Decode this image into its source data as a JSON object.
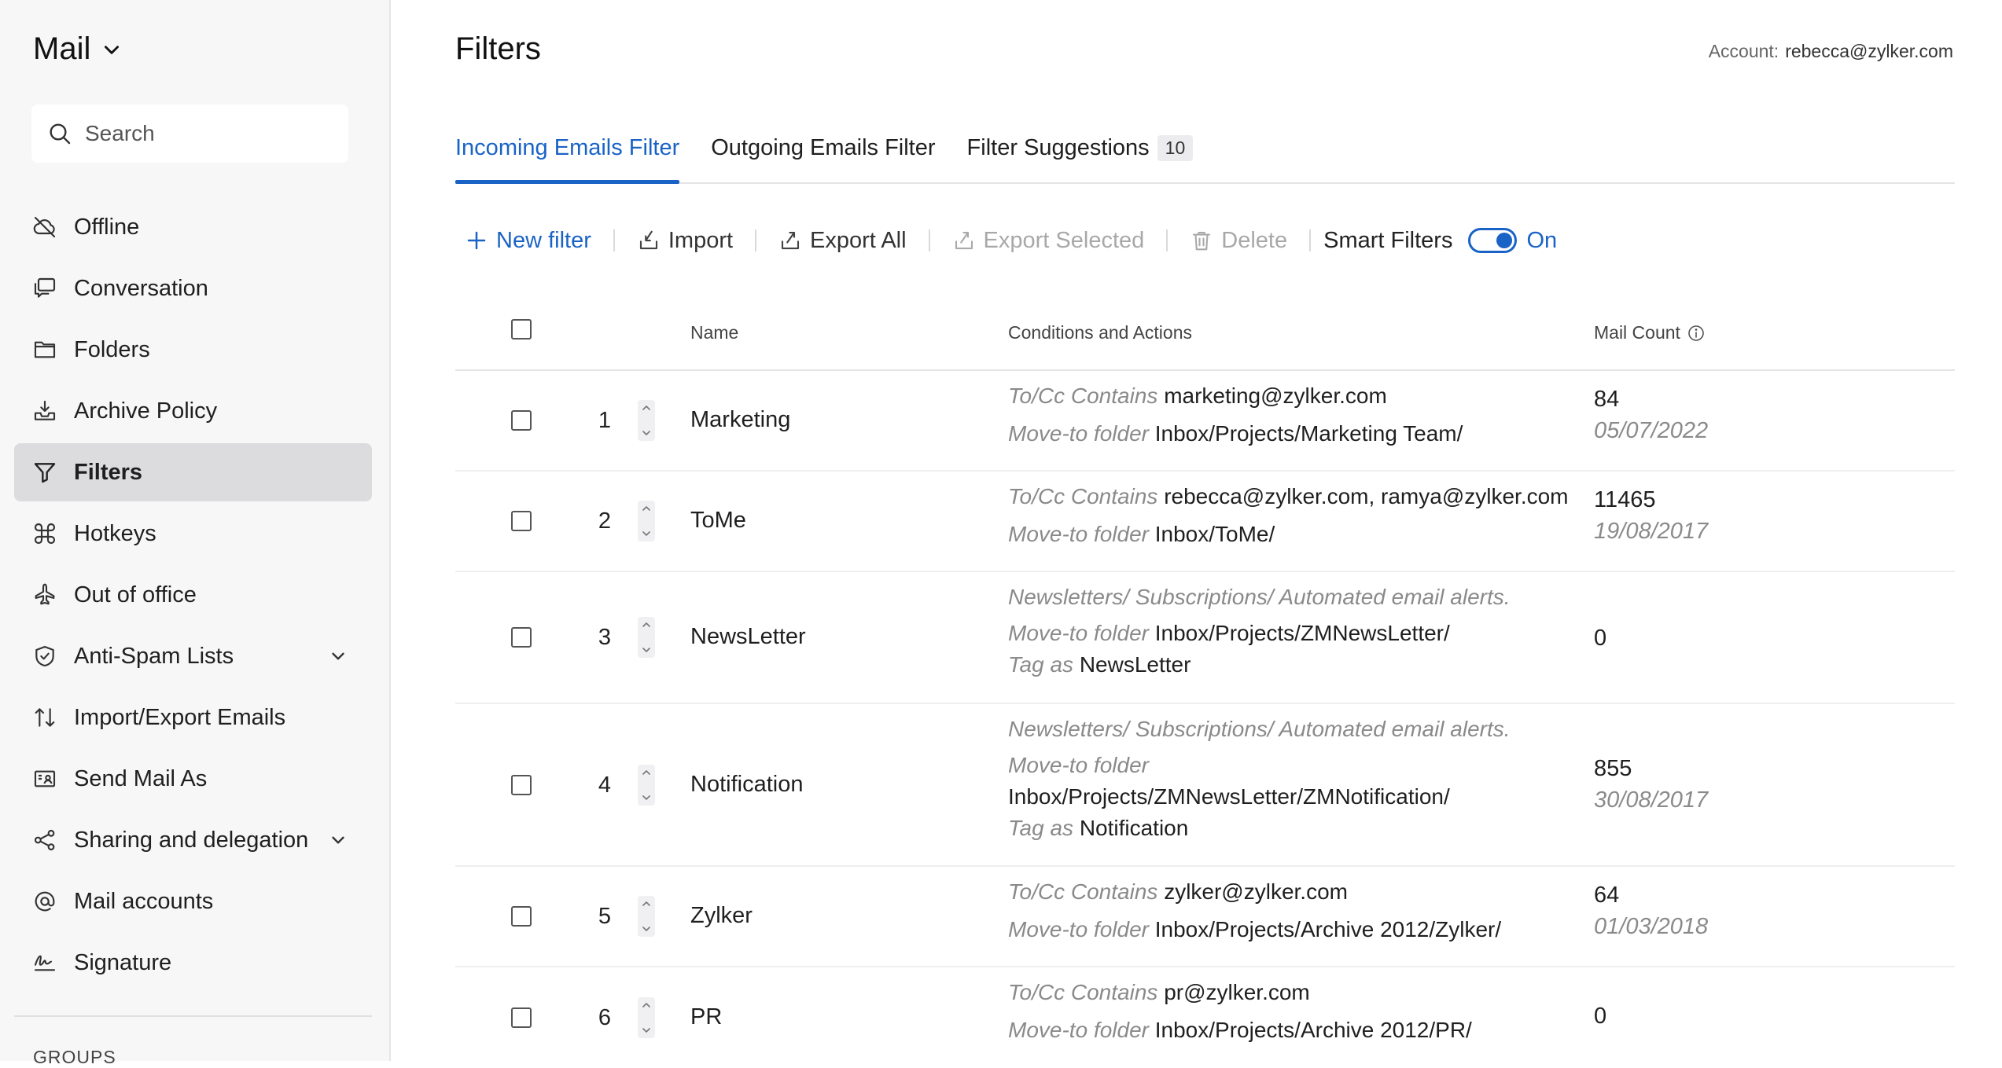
{
  "sidebar": {
    "app_title": "Mail",
    "search_placeholder": "Search",
    "items": [
      {
        "label": "Offline",
        "icon": "offline-icon"
      },
      {
        "label": "Conversation",
        "icon": "conversation-icon"
      },
      {
        "label": "Folders",
        "icon": "folder-icon"
      },
      {
        "label": "Archive Policy",
        "icon": "archive-icon"
      },
      {
        "label": "Filters",
        "icon": "filter-icon",
        "active": true
      },
      {
        "label": "Hotkeys",
        "icon": "command-icon"
      },
      {
        "label": "Out of office",
        "icon": "plane-icon"
      },
      {
        "label": "Anti-Spam Lists",
        "icon": "shield-icon",
        "expandable": true
      },
      {
        "label": "Import/Export Emails",
        "icon": "import-export-icon"
      },
      {
        "label": "Send Mail As",
        "icon": "send-mail-as-icon"
      },
      {
        "label": "Sharing and delegation",
        "icon": "share-icon",
        "expandable": true
      },
      {
        "label": "Mail accounts",
        "icon": "at-icon"
      },
      {
        "label": "Signature",
        "icon": "signature-icon"
      }
    ],
    "groups_label": "GROUPS"
  },
  "header": {
    "title": "Filters",
    "account_label": "Account:",
    "account_value": "rebecca@zylker.com"
  },
  "tabs": [
    {
      "label": "Incoming Emails Filter",
      "active": true
    },
    {
      "label": "Outgoing Emails Filter"
    },
    {
      "label": "Filter Suggestions",
      "badge": "10"
    }
  ],
  "toolbar": {
    "new_filter": "New filter",
    "import": "Import",
    "export_all": "Export All",
    "export_selected": "Export Selected",
    "delete": "Delete",
    "smart_filters": "Smart Filters",
    "smart_filters_state": "On"
  },
  "table": {
    "headers": {
      "name": "Name",
      "conditions": "Conditions and Actions",
      "mail_count": "Mail Count"
    },
    "rows": [
      {
        "num": "1",
        "name": "Marketing",
        "lines": [
          {
            "label": "To/Cc Contains",
            "value": "marketing@zylker.com"
          },
          {
            "label": "Move-to folder",
            "value": "Inbox/Projects/Marketing Team/"
          }
        ],
        "count": "84",
        "date": "05/07/2022"
      },
      {
        "num": "2",
        "name": "ToMe",
        "lines": [
          {
            "label": "To/Cc Contains",
            "value": "rebecca@zylker.com, ramya@zylker.com"
          },
          {
            "label": "Move-to folder",
            "value": "Inbox/ToMe/"
          }
        ],
        "count": "11465",
        "date": "19/08/2017"
      },
      {
        "num": "3",
        "name": "NewsLetter",
        "lines": [
          {
            "label": "Newsletters/ Subscriptions/ Automated email alerts.",
            "value": ""
          },
          {
            "label": "Move-to folder",
            "value": "Inbox/Projects/ZMNewsLetter/"
          },
          {
            "label": "Tag as",
            "value": "NewsLetter"
          }
        ],
        "count": "0",
        "date": ""
      },
      {
        "num": "4",
        "name": "Notification",
        "lines": [
          {
            "label": "Newsletters/ Subscriptions/ Automated email alerts.",
            "value": ""
          },
          {
            "label": "Move-to folder",
            "value": ""
          },
          {
            "label": "",
            "value": "Inbox/Projects/ZMNewsLetter/ZMNotification/"
          },
          {
            "label": "Tag as",
            "value": "Notification"
          }
        ],
        "count": "855",
        "date": "30/08/2017"
      },
      {
        "num": "5",
        "name": "Zylker",
        "lines": [
          {
            "label": "To/Cc Contains",
            "value": "zylker@zylker.com"
          },
          {
            "label": "Move-to folder",
            "value": "Inbox/Projects/Archive 2012/Zylker/"
          }
        ],
        "count": "64",
        "date": "01/03/2018"
      },
      {
        "num": "6",
        "name": "PR",
        "lines": [
          {
            "label": "To/Cc Contains",
            "value": "pr@zylker.com"
          },
          {
            "label": "Move-to folder",
            "value": "Inbox/Projects/Archive 2012/PR/"
          }
        ],
        "count": "0",
        "date": ""
      }
    ]
  },
  "colors": {
    "accent": "#1a63c6",
    "sidebar_bg": "#f7f7f8",
    "active_item_bg": "#dcdcdf",
    "muted": "#8a8a8a"
  }
}
